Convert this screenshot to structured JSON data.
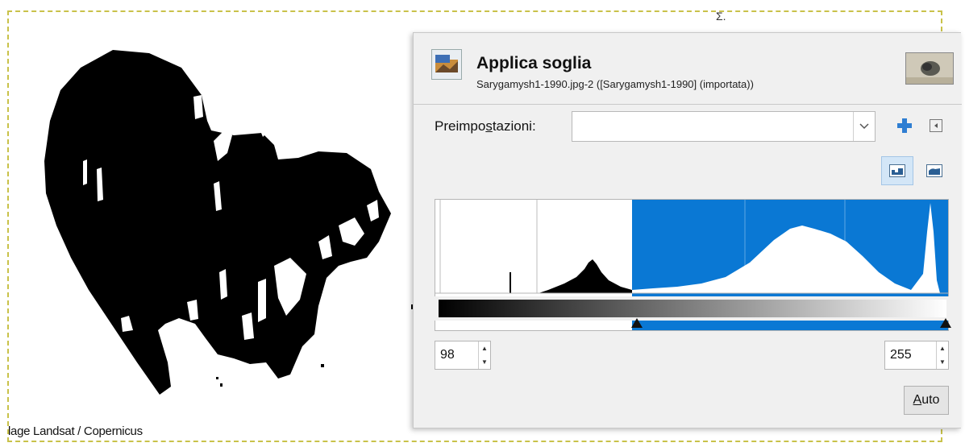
{
  "canvas": {
    "credit_text": "lage Landsat / Copernicus",
    "corner_mark": "Σ."
  },
  "dialog": {
    "title": "Applica soglia",
    "subtitle": "Sarygamysh1-1990.jpg-2 ([Sarygamysh1-1990] (importata))",
    "presets_label_pre": "Preimpo",
    "presets_label_ul": "s",
    "presets_label_post": "tazioni:",
    "presets_value": "",
    "icons": {
      "tool": "threshold-tool-icon",
      "add_preset": "plus-icon",
      "menu": "dialog-menu-icon",
      "linear": "linear-histogram-icon",
      "log": "log-histogram-icon"
    },
    "threshold_low": "98",
    "threshold_high": "255",
    "auto_label_ul": "A",
    "auto_label_rest": "uto",
    "accent_color": "#0a78d4"
  }
}
